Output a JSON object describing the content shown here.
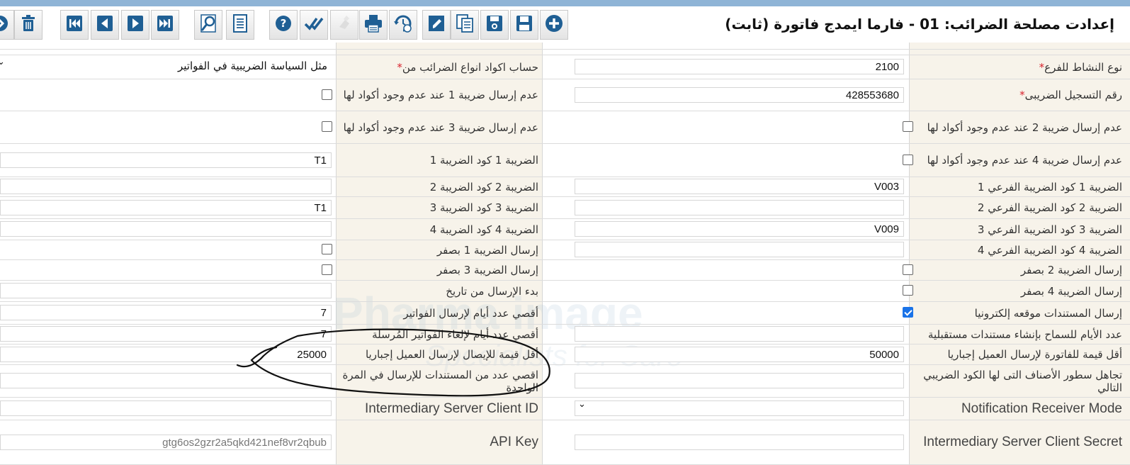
{
  "window": {
    "title": "إعدادت مصلحة الضرائب: 01 - فارما ايمدج فاتورة (ثابت)"
  },
  "toolbar": {
    "buttons": [
      {
        "name": "exit-button",
        "icon": "exit-icon"
      },
      {
        "name": "delete-button",
        "icon": "trash-icon"
      },
      {
        "name": "first-record-button",
        "icon": "skip-first-icon"
      },
      {
        "name": "previous-record-button",
        "icon": "previous-icon"
      },
      {
        "name": "next-record-button",
        "icon": "next-icon"
      },
      {
        "name": "last-record-button",
        "icon": "skip-last-icon"
      },
      {
        "name": "search-button",
        "icon": "magnifier-icon"
      },
      {
        "name": "report-button",
        "icon": "document-icon"
      },
      {
        "name": "help-button",
        "icon": "help-icon"
      },
      {
        "name": "approve-button",
        "icon": "double-check-icon"
      },
      {
        "name": "clear-button",
        "icon": "eraser-icon"
      },
      {
        "name": "print-button",
        "icon": "printer-icon"
      },
      {
        "name": "history-button",
        "icon": "history-icon"
      },
      {
        "name": "edit-button",
        "icon": "pencil-icon"
      },
      {
        "name": "copy-button",
        "icon": "copy-icon"
      },
      {
        "name": "save-as-button",
        "icon": "save-as-icon"
      },
      {
        "name": "save-button",
        "icon": "floppy-icon"
      },
      {
        "name": "add-button",
        "icon": "plus-icon"
      }
    ]
  },
  "form": {
    "right": [
      {
        "label": "نوع النشاط للفرع",
        "required": true,
        "type": "text",
        "value": "2100"
      },
      {
        "label": "رقم التسجيل الضريبى",
        "required": true,
        "type": "text",
        "value": "428553680"
      },
      {
        "label": "عدم إرسال ضريبة 2 عند عدم وجود أكواد لها",
        "type": "checkbox",
        "checked": false
      },
      {
        "label": "عدم إرسال ضريبة 4 عند عدم وجود أكواد لها",
        "type": "checkbox",
        "checked": false
      },
      {
        "label": "الضريبة 1 كود الضريبة الفرعي 1",
        "type": "text",
        "value": "V003"
      },
      {
        "label": "الضريبة 2 كود الضريبة الفرعي 2",
        "type": "text",
        "value": ""
      },
      {
        "label": "الضريبة 3 كود الضريبة الفرعي 3",
        "type": "text",
        "value": "V009"
      },
      {
        "label": "الضريبة 4 كود الضريبة الفرعي 4",
        "type": "text",
        "value": ""
      },
      {
        "label": "إرسال الضريبة 2 بصفر",
        "type": "checkbox",
        "checked": false
      },
      {
        "label": "إرسال الضريبة 4 بصفر",
        "type": "checkbox",
        "checked": false
      },
      {
        "label": "إرسال المستندات موقعه إلكترونيا",
        "type": "checkbox",
        "checked": true
      },
      {
        "label": "عدد الأيام للسماح بإنشاء مستندات مستقبلية",
        "type": "text",
        "value": ""
      },
      {
        "label": "أقل قيمة للفاتورة لإرسال العميل إجباريا",
        "type": "text",
        "value": "50000"
      },
      {
        "label": "تجاهل سطور الأصناف التى لها الكود الضريبي التالي",
        "type": "text",
        "value": ""
      },
      {
        "label": "Notification Receiver Mode",
        "type": "select",
        "value": ""
      },
      {
        "label": "Intermediary Server Client Secret",
        "type": "text",
        "value": ""
      }
    ],
    "left": [
      {
        "label": "حساب اكواد انواع الضرائب من",
        "required": true,
        "type": "select",
        "value": "مثل السياسة الضريبية في الفواتير"
      },
      {
        "label": "عدم إرسال ضريبة 1 عند عدم وجود أكواد لها",
        "type": "checkbox",
        "checked": false
      },
      {
        "label": "عدم إرسال ضريبة 3 عند عدم وجود أكواد لها",
        "type": "checkbox",
        "checked": false
      },
      {
        "label": "الضريبة 1 كود الضريبة 1",
        "type": "text",
        "value": "T1"
      },
      {
        "label": "الضريبة 2 كود الضريبة 2",
        "type": "text",
        "value": ""
      },
      {
        "label": "الضريبة 3 كود الضريبة 3",
        "type": "text",
        "value": "T1"
      },
      {
        "label": "الضريبة 4 كود الضريبة 4",
        "type": "text",
        "value": ""
      },
      {
        "label": "إرسال الضريبة 1 بصفر",
        "type": "checkbox",
        "checked": false
      },
      {
        "label": "إرسال الضريبة 3 بصفر",
        "type": "checkbox",
        "checked": false
      },
      {
        "label": "بدء الإرسال من تاريخ",
        "type": "text",
        "value": ""
      },
      {
        "label": "أقصي عدد أيام لإرسال الفواتير",
        "type": "text",
        "value": "7"
      },
      {
        "label": "أقصي عدد أيام لإلغاء الفواتير المُرسلة",
        "type": "text",
        "value": "7"
      },
      {
        "label": "أقل قيمة للإيصال لإرسال العميل إجباريا",
        "type": "text",
        "value": "25000"
      },
      {
        "label": "اقصي عدد من المستندات للإرسال في المرة الواحدة",
        "type": "text",
        "value": ""
      },
      {
        "label": "Intermediary Server Client ID",
        "type": "text",
        "value": ""
      },
      {
        "label": "API Key",
        "type": "text",
        "value": "gtg6os2gzr2a5qkd421nef8vr2qbub"
      }
    ]
  },
  "watermark": {
    "line1": "Pharma image",
    "line2": "Specialists for Care"
  },
  "colors": {
    "label_bg": "#f7f3ea",
    "required": "#d9232e",
    "toolbar_accent": "#1f5f94",
    "checkbox_checked": "#1a73e8"
  }
}
